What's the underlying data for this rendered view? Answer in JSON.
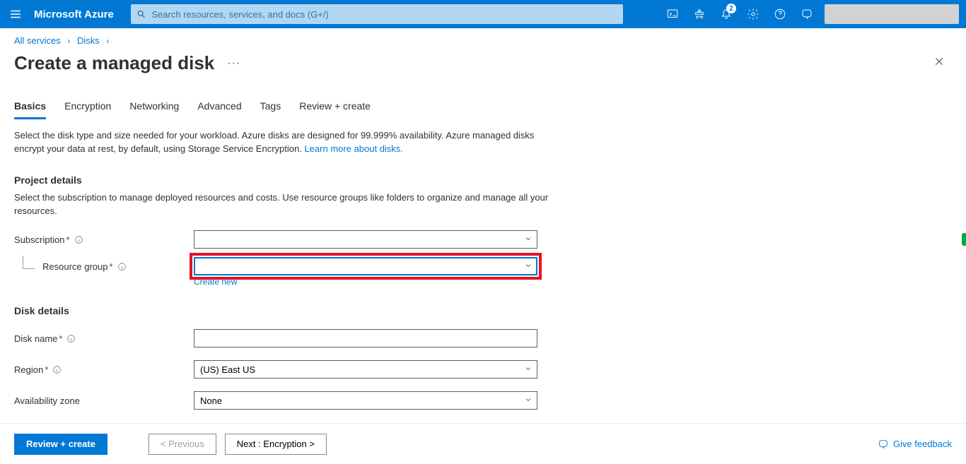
{
  "topbar": {
    "brand": "Microsoft Azure",
    "search_placeholder": "Search resources, services, and docs (G+/)",
    "notification_count": "2"
  },
  "breadcrumbs": {
    "item1": "All services",
    "item2": "Disks"
  },
  "page": {
    "title": "Create a managed disk"
  },
  "tabs": {
    "basics": "Basics",
    "encryption": "Encryption",
    "networking": "Networking",
    "advanced": "Advanced",
    "tags": "Tags",
    "review": "Review + create"
  },
  "intro": {
    "text": "Select the disk type and size needed for your workload. Azure disks are designed for 99.999% availability. Azure managed disks encrypt your data at rest, by default, using Storage Service Encryption.  ",
    "link": "Learn more about disks."
  },
  "sections": {
    "project_head": "Project details",
    "project_sub": "Select the subscription to manage deployed resources and costs. Use resource groups like folders to organize and manage all your resources.",
    "disk_head": "Disk details"
  },
  "labels": {
    "subscription": "Subscription",
    "resource_group": "Resource group",
    "create_new": "Create new",
    "disk_name": "Disk name",
    "region": "Region",
    "avail_zone": "Availability zone"
  },
  "values": {
    "subscription": " ",
    "resource_group": "",
    "disk_name": "",
    "region": "(US) East US",
    "avail_zone": "None"
  },
  "footer": {
    "review": "Review + create",
    "prev": "< Previous",
    "next": "Next : Encryption >",
    "feedback": "Give feedback"
  }
}
